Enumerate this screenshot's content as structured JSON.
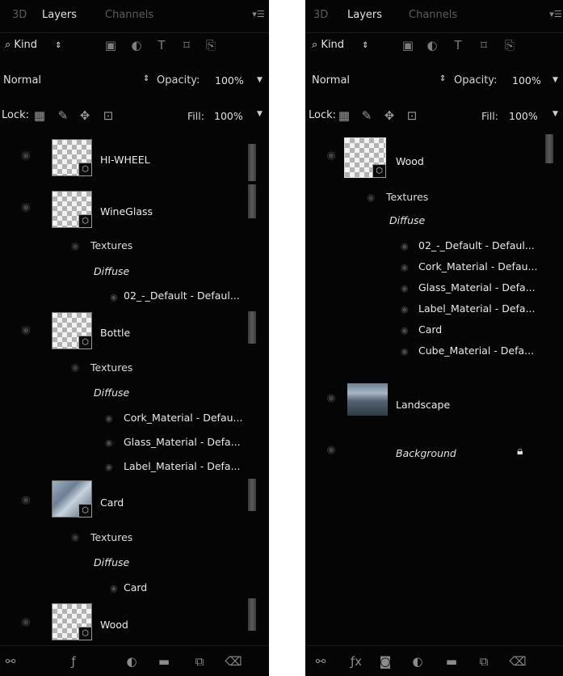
{
  "left": {
    "tabs": [
      "3D",
      "Layers",
      "Channels"
    ],
    "kind": "Kind",
    "blend": "Normal",
    "opacity_label": "Opacity:",
    "opacity": "100%",
    "lock_label": "Lock:",
    "fill_label": "Fill:",
    "fill": "100%",
    "layers": [
      {
        "name": "HI-WHEEL"
      },
      {
        "name": "WineGlass",
        "textures": "Textures",
        "diffuse": "Diffuse",
        "materials": [
          "02_-_Default - Defaul..."
        ]
      },
      {
        "name": "Bottle",
        "textures": "Textures",
        "diffuse": "Diffuse",
        "materials": [
          "Cork_Material - Defau...",
          "Glass_Material - Defa...",
          "Label_Material - Defa..."
        ]
      },
      {
        "name": "Card",
        "textures": "Textures",
        "diffuse": "Diffuse",
        "materials": [
          "Card"
        ]
      },
      {
        "name": "Wood"
      }
    ]
  },
  "right": {
    "tabs": [
      "3D",
      "Layers",
      "Channels"
    ],
    "kind": "Kind",
    "blend": "Normal",
    "opacity_label": "Opacity:",
    "opacity": "100%",
    "lock_label": "Lock:",
    "fill_label": "Fill:",
    "fill": "100%",
    "layers": [
      {
        "name": "Wood",
        "textures": "Textures",
        "diffuse": "Diffuse",
        "materials": [
          "02_-_Default - Defaul...",
          "Cork_Material - Defau...",
          "Glass_Material - Defa...",
          "Label_Material - Defa...",
          "Card",
          "Cube_Material - Defa..."
        ]
      },
      {
        "name": "Landscape"
      },
      {
        "name": "Background"
      }
    ]
  },
  "icons": {
    "eye": "eye-icon",
    "texture": "texture-eye-icon",
    "lock": "lock-icon",
    "link": "link-layers-icon",
    "fx": "fx-icon",
    "mask": "mask-icon",
    "adjust": "adjustment-icon",
    "folder": "folder-icon",
    "new": "new-layer-icon",
    "trash": "trash-icon"
  }
}
